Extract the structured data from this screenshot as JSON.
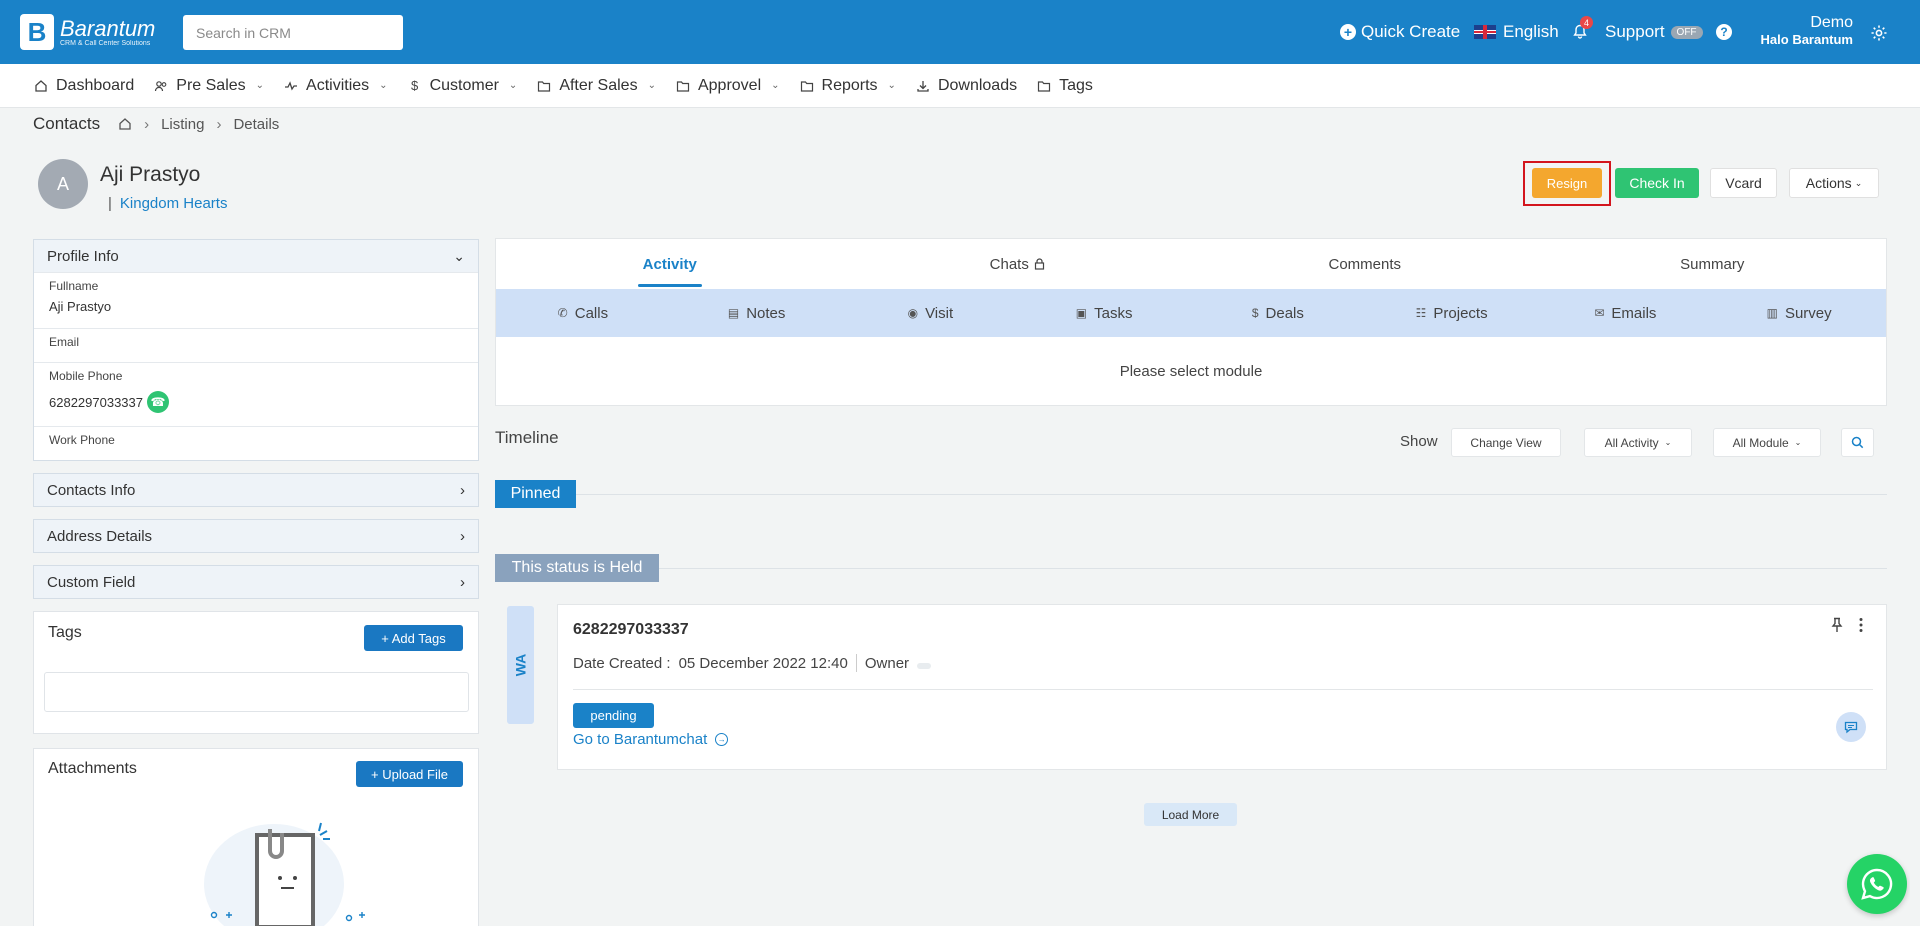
{
  "app": {
    "logo_name": "Barantum",
    "logo_tagline": "CRM & Call Center Solutions",
    "search_placeholder": "Search in CRM",
    "quick_create": "Quick Create",
    "language": "English",
    "notification_count": "4",
    "support": "Support",
    "support_status": "OFF",
    "user_name": "Demo",
    "user_org": "Halo Barantum"
  },
  "nav": [
    {
      "label": "Dashboard",
      "icon": "home-icon",
      "dropdown": false
    },
    {
      "label": "Pre Sales",
      "icon": "users-icon",
      "dropdown": true
    },
    {
      "label": "Activities",
      "icon": "pulse-icon",
      "dropdown": true
    },
    {
      "label": "Customer",
      "icon": "dollar-icon",
      "dropdown": true
    },
    {
      "label": "After Sales",
      "icon": "folder-icon",
      "dropdown": true
    },
    {
      "label": "Approvel",
      "icon": "folder-icon",
      "dropdown": true
    },
    {
      "label": "Reports",
      "icon": "folder-icon",
      "dropdown": true
    },
    {
      "label": "Downloads",
      "icon": "download-icon",
      "dropdown": false
    },
    {
      "label": "Tags",
      "icon": "folder-icon",
      "dropdown": false
    }
  ],
  "breadcrumb": {
    "title": "Contacts",
    "items": [
      "Listing",
      "Details"
    ]
  },
  "contact": {
    "initial": "A",
    "name": "Aji Prastyo",
    "company": "Kingdom Hearts"
  },
  "actions": {
    "resign": "Resign",
    "check_in": "Check In",
    "vcard": "Vcard",
    "actions": "Actions"
  },
  "profile_info": {
    "title": "Profile Info",
    "fields": [
      {
        "label": "Fullname",
        "value": "Aji Prastyo"
      },
      {
        "label": "Email",
        "value": ""
      },
      {
        "label": "Mobile Phone",
        "value": "6282297033337"
      },
      {
        "label": "Work Phone",
        "value": ""
      }
    ]
  },
  "sections": [
    "Contacts Info",
    "Address Details",
    "Custom Field"
  ],
  "tags": {
    "title": "Tags",
    "add_button": "+ Add Tags"
  },
  "attachments": {
    "title": "Attachments",
    "upload_button": "+ Upload File"
  },
  "tabs": [
    "Activity",
    "Chats",
    "Comments",
    "Summary"
  ],
  "modules": [
    {
      "label": "Calls",
      "icon": "phone-icon"
    },
    {
      "label": "Notes",
      "icon": "calendar-icon"
    },
    {
      "label": "Visit",
      "icon": "map-pin-icon"
    },
    {
      "label": "Tasks",
      "icon": "briefcase-icon"
    },
    {
      "label": "Deals",
      "icon": "dollar-icon"
    },
    {
      "label": "Projects",
      "icon": "hierarchy-icon"
    },
    {
      "label": "Emails",
      "icon": "mail-icon"
    },
    {
      "label": "Survey",
      "icon": "document-icon"
    }
  ],
  "module_message": "Please select module",
  "timeline": {
    "title": "Timeline",
    "show": "Show",
    "change_view": "Change View",
    "all_activity": "All Activity",
    "all_module": "All Module",
    "pinned": "Pinned",
    "held": "This status is Held",
    "load_more": "Load More"
  },
  "activity": {
    "channel": "WA",
    "number": "6282297033337",
    "date_label": "Date Created :",
    "date_value": "05 December 2022 12:40",
    "owner_label": "Owner",
    "status": "pending",
    "link": "Go to Barantumchat"
  },
  "colors": {
    "primary": "#1a82c8",
    "resign": "#f4a72e",
    "check_in": "#2fc473",
    "held": "#8aa2bd",
    "module_bar": "#cfe0f7"
  }
}
